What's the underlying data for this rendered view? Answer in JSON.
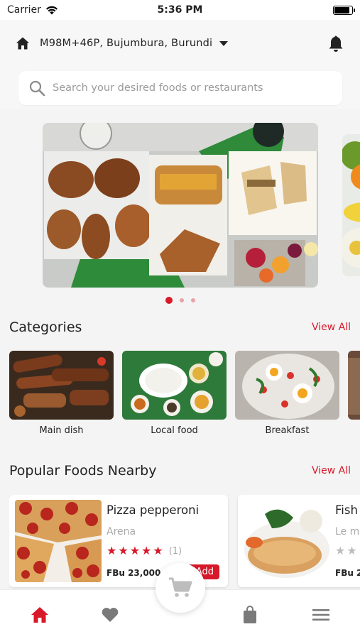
{
  "status_bar": {
    "carrier": "Carrier",
    "time": "5:36 PM",
    "battery_level": 0.9
  },
  "header": {
    "location": "M98M+46P, Bujumbura, Burundi",
    "search_placeholder": "Search your desired foods or restaurants"
  },
  "banner": {
    "slides": 3,
    "active_slide": 1
  },
  "categories": {
    "title": "Categories",
    "view_all": "View All",
    "items": [
      {
        "label": "Main dish"
      },
      {
        "label": "Local food"
      },
      {
        "label": "Breakfast"
      }
    ]
  },
  "popular": {
    "title": "Popular Foods Nearby",
    "view_all": "View All",
    "items": [
      {
        "name": "Pizza pepperoni",
        "restaurant": "Arena",
        "rating": 5,
        "rating_count": "(1)",
        "price": "FBu 23,000",
        "add_label": "Add"
      },
      {
        "name": "Fish",
        "restaurant": "Le m",
        "rating": 2,
        "price": "FBu 2"
      }
    ]
  },
  "nav": {
    "items": [
      "home-icon",
      "heart-icon",
      "cart-icon",
      "bag-icon",
      "menu-icon"
    ],
    "active": "home-icon"
  },
  "colors": {
    "accent": "#d7192a",
    "inactive_icon": "#7a7a7a",
    "background": "#f4f4f4"
  }
}
